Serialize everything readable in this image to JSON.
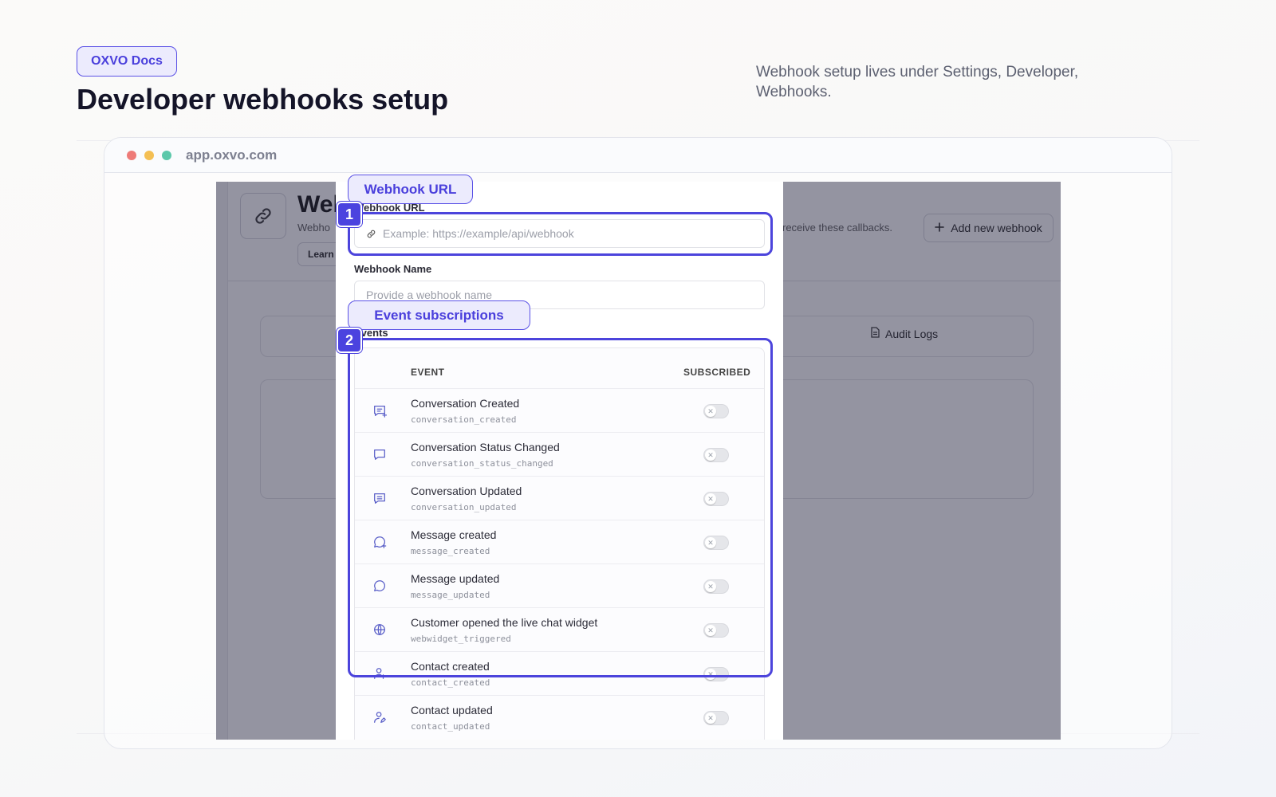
{
  "docs": {
    "badge": "OXVO Docs",
    "title": "Developer webhooks setup",
    "subtitle": "Webhook setup lives under Settings, Developer, Webhooks."
  },
  "browser": {
    "url": "app.oxvo.com",
    "dots": [
      "#ee7b78",
      "#f4bf53",
      "#5cc8aa"
    ]
  },
  "app": {
    "header_title": "Web",
    "header_subtitle": "Webho",
    "header_subtitle_right": "receive these callbacks.",
    "learn_button": "Learn",
    "add_button": "Add new webhook",
    "audit_tab": "Audit Logs"
  },
  "modal": {
    "url_label": "Webhook URL",
    "url_placeholder": "Example: https://example/api/webhook",
    "name_label": "Webhook Name",
    "name_placeholder": "Provide a webhook name",
    "events_label": "Events",
    "table": {
      "col_event": "EVENT",
      "col_subscribed": "SUBSCRIBED",
      "rows": [
        {
          "name": "Conversation Created",
          "code": "conversation_created",
          "icon": "chat-add-icon",
          "subscribed": false
        },
        {
          "name": "Conversation Status Changed",
          "code": "conversation_status_changed",
          "icon": "chat-bubble-icon",
          "subscribed": false
        },
        {
          "name": "Conversation Updated",
          "code": "conversation_updated",
          "icon": "chat-lines-icon",
          "subscribed": false
        },
        {
          "name": "Message created",
          "code": "message_created",
          "icon": "message-add-icon",
          "subscribed": false
        },
        {
          "name": "Message updated",
          "code": "message_updated",
          "icon": "message-round-icon",
          "subscribed": false
        },
        {
          "name": "Customer opened the live chat widget",
          "code": "webwidget_triggered",
          "icon": "globe-icon",
          "subscribed": false
        },
        {
          "name": "Contact created",
          "code": "contact_created",
          "icon": "person-add-icon",
          "subscribed": false
        },
        {
          "name": "Contact updated",
          "code": "contact_updated",
          "icon": "person-edit-icon",
          "subscribed": false
        }
      ]
    }
  },
  "callouts": [
    {
      "number": "1",
      "label": "Webhook URL"
    },
    {
      "number": "2",
      "label": "Event subscriptions"
    }
  ],
  "colors": {
    "accent": "#4c44dc",
    "accent_soft": "#ecebfd"
  }
}
